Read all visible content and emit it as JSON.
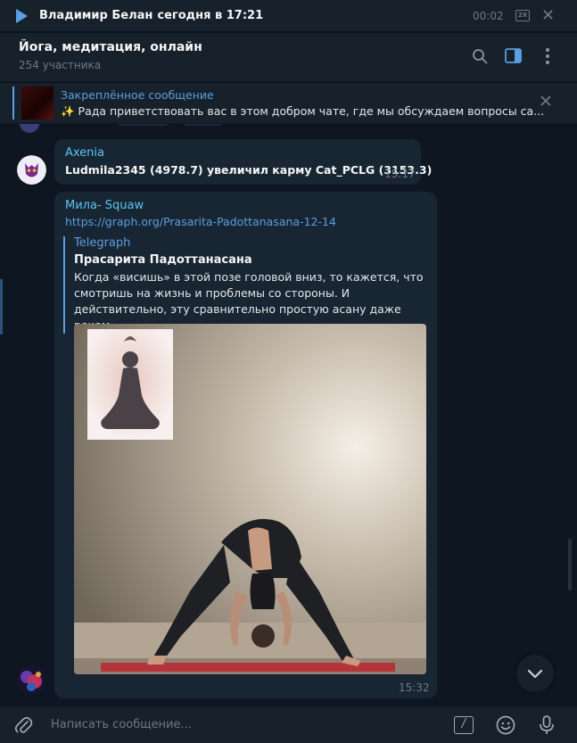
{
  "player": {
    "title": "Владимир Белан",
    "subtitle": "сегодня в 17:21",
    "time": "00:02",
    "speed": "2X",
    "close": "✕"
  },
  "header": {
    "title": "Йога, медитация, онлайн",
    "members": "254 участника"
  },
  "pinned": {
    "title": "Закреплённое сообщение",
    "text": "✨ Рада приветствовать вас в этом добром чате, где мы обсуждаем вопросы са...",
    "close": "✕"
  },
  "messages": [
    {
      "sender": "Axenia",
      "text": "Ludmila2345 (4978.7) увеличил карму Cat_PCLG (3153.3)",
      "time": "15:17"
    },
    {
      "sender": "Мила- Squaw",
      "link": "https://graph.org/Prasarita-Padottanasana-12-14",
      "preview": {
        "site": "Telegraph",
        "title": "Прасарита Падоттанасана",
        "description": "Когда «висишь» в этой позе головой вниз, то кажется, что смотришь на жизнь и проблемы со стороны. И действительно, эту сравнительно простую асану даже реком..."
      },
      "time": "15:32"
    }
  ],
  "compose": {
    "placeholder": "Написать сообщение...",
    "command": "/"
  },
  "colors": {
    "background": "#0e1621",
    "panel": "#17212b",
    "bubble": "#182533",
    "accent": "#5a9fe0",
    "sender": "#5ac6f0",
    "muted": "#6d7883"
  },
  "icons": [
    "play-icon",
    "speed-icon",
    "close-icon",
    "search-icon",
    "side-panel-icon",
    "more-icon",
    "pinned-close-icon",
    "chevron-down-icon",
    "attach-icon",
    "command-icon",
    "emoji-icon",
    "microphone-icon"
  ]
}
